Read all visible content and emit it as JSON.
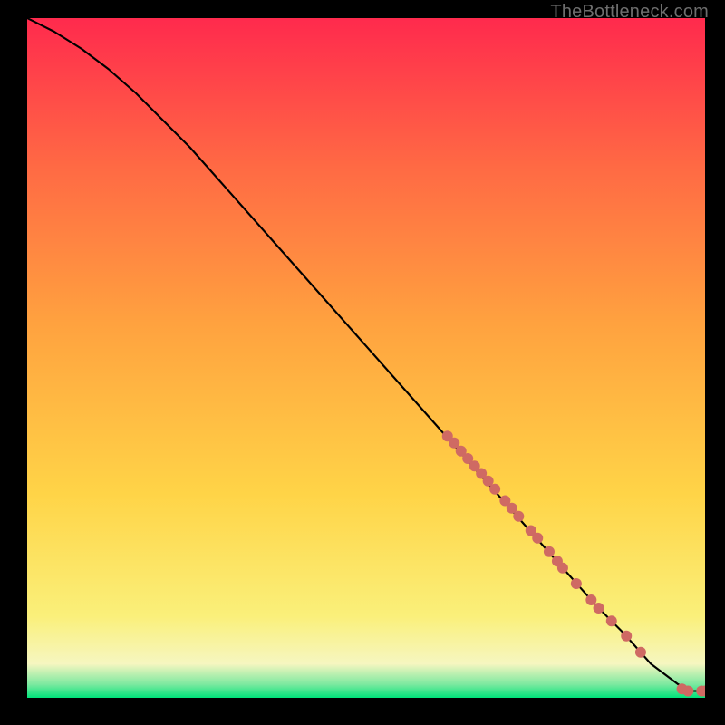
{
  "watermark": "TheBottleneck.com",
  "chart_data": {
    "type": "line",
    "title": "",
    "xlabel": "",
    "ylabel": "",
    "xlim": [
      0,
      100
    ],
    "ylim": [
      0,
      100
    ],
    "background_gradient": {
      "stops": [
        {
          "pos": 0.0,
          "color": "#00e37a"
        },
        {
          "pos": 0.02,
          "color": "#7de9a0"
        },
        {
          "pos": 0.05,
          "color": "#f6f6c0"
        },
        {
          "pos": 0.12,
          "color": "#faf07a"
        },
        {
          "pos": 0.3,
          "color": "#ffd447"
        },
        {
          "pos": 0.55,
          "color": "#ffa23f"
        },
        {
          "pos": 0.78,
          "color": "#ff6a44"
        },
        {
          "pos": 1.0,
          "color": "#ff2a4d"
        }
      ]
    },
    "curve": {
      "x": [
        0,
        4,
        8,
        12,
        16,
        20,
        24,
        28,
        32,
        36,
        40,
        44,
        48,
        52,
        56,
        60,
        64,
        68,
        72,
        76,
        80,
        84,
        88,
        92,
        94,
        96,
        98,
        100
      ],
      "y": [
        100,
        98,
        95.5,
        92.5,
        89,
        85,
        81,
        76.5,
        72,
        67.5,
        63,
        58.5,
        54,
        49.5,
        45,
        40.5,
        36,
        31.5,
        27,
        22.5,
        18,
        13.5,
        9.5,
        5,
        3.5,
        2,
        1,
        1
      ]
    },
    "highlight_points": {
      "color": "#cf6a63",
      "radius": 6,
      "points": [
        {
          "x": 62,
          "y": 38.5
        },
        {
          "x": 63,
          "y": 37.5
        },
        {
          "x": 64,
          "y": 36.3
        },
        {
          "x": 65,
          "y": 35.2
        },
        {
          "x": 66,
          "y": 34.1
        },
        {
          "x": 67,
          "y": 33.0
        },
        {
          "x": 68,
          "y": 31.9
        },
        {
          "x": 69,
          "y": 30.7
        },
        {
          "x": 70.5,
          "y": 29.0
        },
        {
          "x": 71.5,
          "y": 27.9
        },
        {
          "x": 72.5,
          "y": 26.7
        },
        {
          "x": 74.3,
          "y": 24.6
        },
        {
          "x": 75.3,
          "y": 23.5
        },
        {
          "x": 77.0,
          "y": 21.5
        },
        {
          "x": 78.2,
          "y": 20.1
        },
        {
          "x": 79.0,
          "y": 19.1
        },
        {
          "x": 81.0,
          "y": 16.8
        },
        {
          "x": 83.2,
          "y": 14.4
        },
        {
          "x": 84.3,
          "y": 13.2
        },
        {
          "x": 86.2,
          "y": 11.3
        },
        {
          "x": 88.4,
          "y": 9.1
        },
        {
          "x": 90.5,
          "y": 6.7
        },
        {
          "x": 96.6,
          "y": 1.3
        },
        {
          "x": 97.5,
          "y": 1.0
        },
        {
          "x": 99.5,
          "y": 1.0
        },
        {
          "x": 100,
          "y": 1.0
        }
      ]
    }
  }
}
